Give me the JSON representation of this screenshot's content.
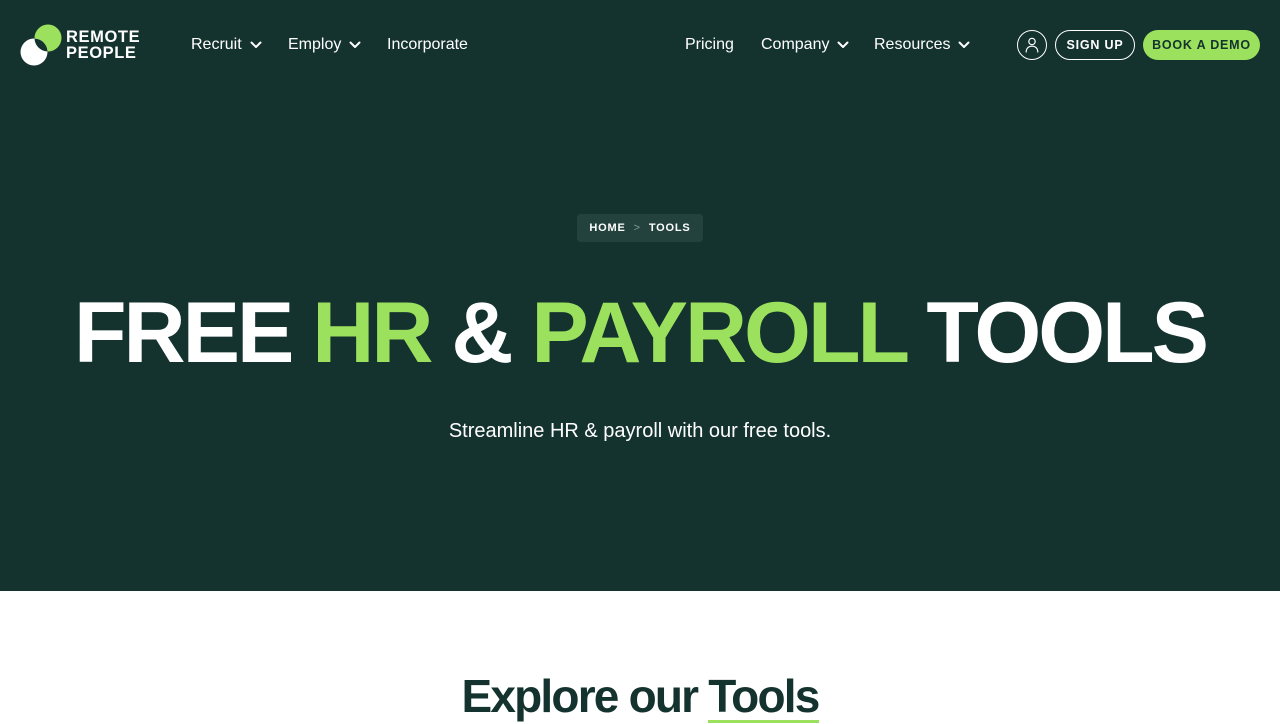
{
  "brand": {
    "line1": "REMOTE",
    "line2": "PEOPLE"
  },
  "nav_left": [
    {
      "label": "Recruit",
      "has_dropdown": true
    },
    {
      "label": "Employ",
      "has_dropdown": true
    },
    {
      "label": "Incorporate",
      "has_dropdown": false
    }
  ],
  "nav_right": [
    {
      "label": "Pricing",
      "has_dropdown": false
    },
    {
      "label": "Company",
      "has_dropdown": true
    },
    {
      "label": "Resources",
      "has_dropdown": true
    }
  ],
  "actions": {
    "account_icon": "user-icon",
    "signup": "SIGN UP",
    "demo": "BOOK A DEMO"
  },
  "breadcrumb": {
    "home": "HOME",
    "separator": ">",
    "current": "TOOLS"
  },
  "hero": {
    "headline": [
      "FREE",
      "HR",
      "&",
      "PAYROLL",
      "TOOLS"
    ],
    "subheading": "Streamline HR & payroll with our free tools."
  },
  "section": {
    "title_part1": "Explore our",
    "title_part2": "Tools"
  },
  "colors": {
    "hero_bg": "#14322e",
    "accent": "#9be15d",
    "text_dark": "#14322e",
    "breadcrumb_bg": "#24423d"
  }
}
